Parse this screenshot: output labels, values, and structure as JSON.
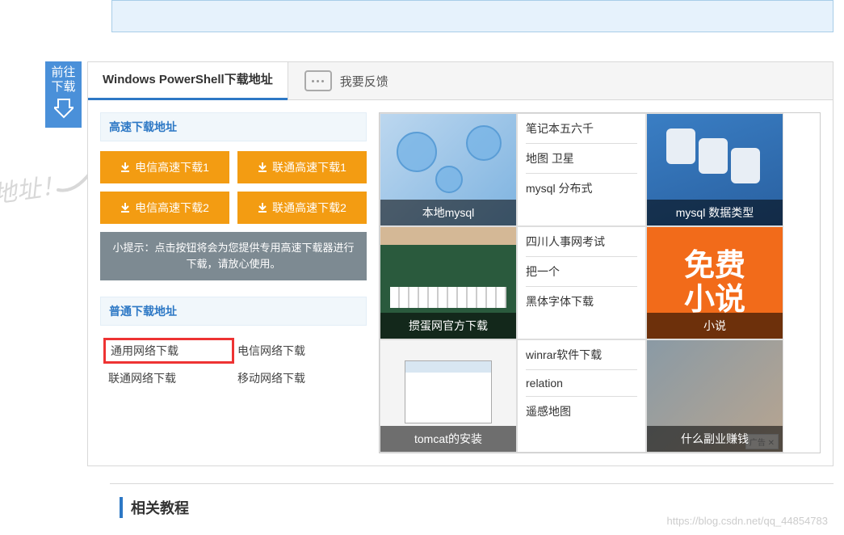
{
  "go_download": {
    "line1": "前往",
    "line2": "下载"
  },
  "bg_hint": "地址！",
  "tabs": {
    "active": "Windows PowerShell下载地址",
    "feedback": "我要反馈"
  },
  "speed_section": {
    "title": "高速下载地址",
    "buttons": [
      "电信高速下载1",
      "联通高速下载1",
      "电信高速下载2",
      "联通高速下载2"
    ],
    "hint": "小提示：点击按钮将会为您提供专用高速下载器进行下载，请放心使用。"
  },
  "normal_section": {
    "title": "普通下载地址",
    "links": [
      "通用网络下载",
      "电信网络下载",
      "联通网络下载",
      "移动网络下载"
    ]
  },
  "ads": {
    "col1": [
      {
        "caption": "本地mysql"
      },
      {
        "caption": "掼蛋网官方下载"
      },
      {
        "caption": "tomcat的安装"
      }
    ],
    "col2": [
      [
        "笔记本五六千",
        "地图 卫星",
        "mysql 分布式"
      ],
      [
        "四川人事网考试",
        "把一个",
        "黑体字体下载"
      ],
      [
        "winrar软件下载",
        "relation",
        "遥感地图"
      ]
    ],
    "col3": [
      {
        "caption": "mysql 数据类型"
      },
      {
        "caption": "小说",
        "big1": "免费",
        "big2": "小说"
      },
      {
        "caption": "什么副业赚钱"
      }
    ],
    "badge": "广告 ✕"
  },
  "related": {
    "title": "相关教程"
  },
  "watermark": "https://blog.csdn.net/qq_44854783"
}
